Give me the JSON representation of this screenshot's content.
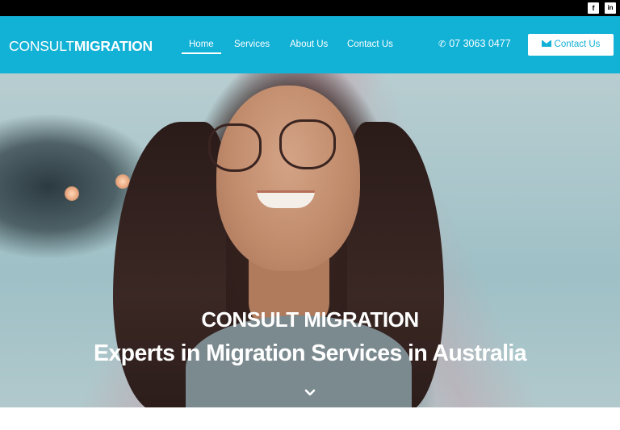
{
  "topbar": {
    "social": [
      {
        "name": "facebook",
        "glyph": "f"
      },
      {
        "name": "linkedin",
        "glyph": "in"
      }
    ]
  },
  "header": {
    "logo": {
      "part1": "CONSULT",
      "part2": "MIGRATION",
      "dots": "•••"
    },
    "nav": [
      {
        "label": "Home",
        "active": true
      },
      {
        "label": "Services",
        "active": false
      },
      {
        "label": "About Us",
        "active": false
      },
      {
        "label": "Contact Us",
        "active": false
      }
    ],
    "phone": {
      "icon": "phone-icon",
      "number": "07 3063 0477"
    },
    "cta": {
      "icon": "mail-icon",
      "label": "Contact Us"
    },
    "colors": {
      "brand": "#12b1d6",
      "topbar": "#000000"
    }
  },
  "hero": {
    "title": "CONSULT MIGRATION",
    "subtitle": "Experts in Migration Services in Australia",
    "scroll_icon": "chevron-down-icon"
  }
}
